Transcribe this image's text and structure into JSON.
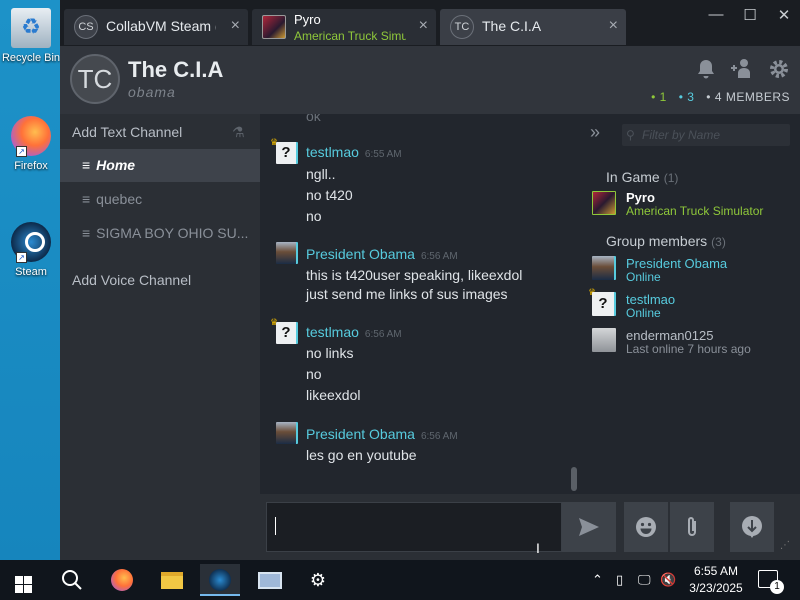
{
  "desktop": {
    "icons": [
      {
        "label": "Recycle Bin",
        "icon": "recycle-bin-icon"
      },
      {
        "label": "Firefox",
        "icon": "firefox-icon"
      },
      {
        "label": "Steam",
        "icon": "steam-icon"
      }
    ]
  },
  "tabs": [
    {
      "avatar": "CS",
      "name": "CollabVM Steam (",
      "close": "×"
    },
    {
      "name": "Pyro",
      "sub": "American Truck Simulator",
      "close": "×"
    },
    {
      "avatar": "TC",
      "name": "The C.I.A",
      "close": "×"
    }
  ],
  "window_controls": {
    "minimize": "—",
    "maximize": "☐",
    "close": "✕"
  },
  "header": {
    "avatar": "TC",
    "title": "The C.I.A",
    "subtitle": "obama",
    "counts": {
      "in_game": "1",
      "online": "3",
      "members": "4 MEMBERS"
    }
  },
  "channels": {
    "add_text": "Add Text Channel",
    "items": [
      {
        "label": "Home",
        "active": true
      },
      {
        "label": "quebec",
        "active": false
      },
      {
        "label": "SIGMA BOY OHIO SU...",
        "active": false
      }
    ],
    "add_voice": "Add Voice Channel"
  },
  "chat": {
    "faded_top": "ok",
    "messages": [
      {
        "author": "testlmao",
        "time": "6:55 AM",
        "lines": [
          "ngll..",
          "no t420",
          "no"
        ]
      },
      {
        "author": "President Obama",
        "time": "6:56 AM",
        "lines": [
          "this is t420user speaking, likeexdol",
          "just send me links of sus images"
        ]
      },
      {
        "author": "testlmao",
        "time": "6:56 AM",
        "lines": [
          "no links",
          "no",
          "likeexdol"
        ]
      },
      {
        "author": "President Obama",
        "time": "6:56 AM",
        "lines": [
          "les go en youtube"
        ]
      }
    ]
  },
  "members": {
    "filter_placeholder": "Filter by Name",
    "groups": [
      {
        "title": "In Game",
        "count": "(1)",
        "members": [
          {
            "name": "Pyro",
            "status": "American Truck Simulator"
          }
        ]
      },
      {
        "title": "Group members",
        "count": "(3)",
        "members": [
          {
            "name": "President Obama",
            "status": "Online"
          },
          {
            "name": "testlmao",
            "status": "Online"
          },
          {
            "name": "enderman0125",
            "status": "Last online 7 hours ago"
          }
        ]
      }
    ]
  },
  "composer": {
    "input_value": "",
    "send": "send-icon",
    "emoji": "emoji-icon",
    "attach": "attach-icon",
    "voice": "voice-icon"
  },
  "taskbar": {
    "time": "6:55 AM",
    "date": "3/23/2025",
    "notification_count": "1"
  },
  "colors": {
    "in_game": "#8fc83a",
    "online": "#57cbde",
    "background": "#22262d",
    "desktop": "#1d92c8"
  }
}
